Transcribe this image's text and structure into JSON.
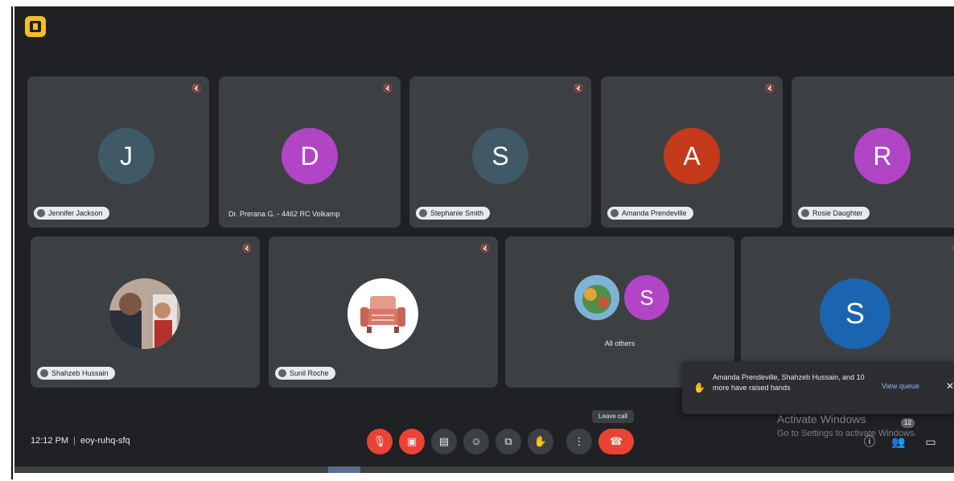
{
  "participants_row1": [
    {
      "initial": "J",
      "name": "Jennifer Jackson",
      "color": "#3f5966",
      "chip": true
    },
    {
      "initial": "D",
      "name": "Dr. Prerana G. - 4462 RC Volkamp",
      "color": "#b145c6",
      "chip": false
    },
    {
      "initial": "S",
      "name": "Stephanie Smith",
      "color": "#3f5966",
      "chip": true
    },
    {
      "initial": "A",
      "name": "Amanda Prendeville",
      "color": "#c4391a",
      "chip": true
    },
    {
      "initial": "R",
      "name": "Rosie Daughter",
      "color": "#b145c6",
      "chip": true
    }
  ],
  "participants_row2": [
    {
      "name": "Shahzeb Hussain",
      "avatar": "photo-icon",
      "chip": true
    },
    {
      "name": "Sunil Roche",
      "avatar": "sofa-icon",
      "chip": true
    },
    {
      "name": "All others",
      "avatar": "group-avatars",
      "initial": "S",
      "color": "#b145c6"
    },
    {
      "initial": "S",
      "name": "",
      "color": "#1a64b0"
    }
  ],
  "toast": {
    "message": "Amanda Prendeville, Shahzeb Hussain, and 10 more have raised hands",
    "action": "View queue"
  },
  "clock": {
    "time": "12:12 PM",
    "meeting_code": "eoy-ruhq-sfq"
  },
  "tooltip": "Leave call",
  "watermark": {
    "line1": "Activate Windows",
    "line2": "Go to Settings to activate Windows."
  },
  "badge": "12",
  "colors": {
    "background": "#202124",
    "tile": "#3c4043",
    "danger": "#ea4335",
    "link": "#8ab4f8"
  },
  "controls": [
    "mic-off-icon",
    "camera-off-icon",
    "captions-icon",
    "emoji-icon",
    "present-icon",
    "raise-hand-icon",
    "more-options-icon",
    "leave-call-icon"
  ]
}
